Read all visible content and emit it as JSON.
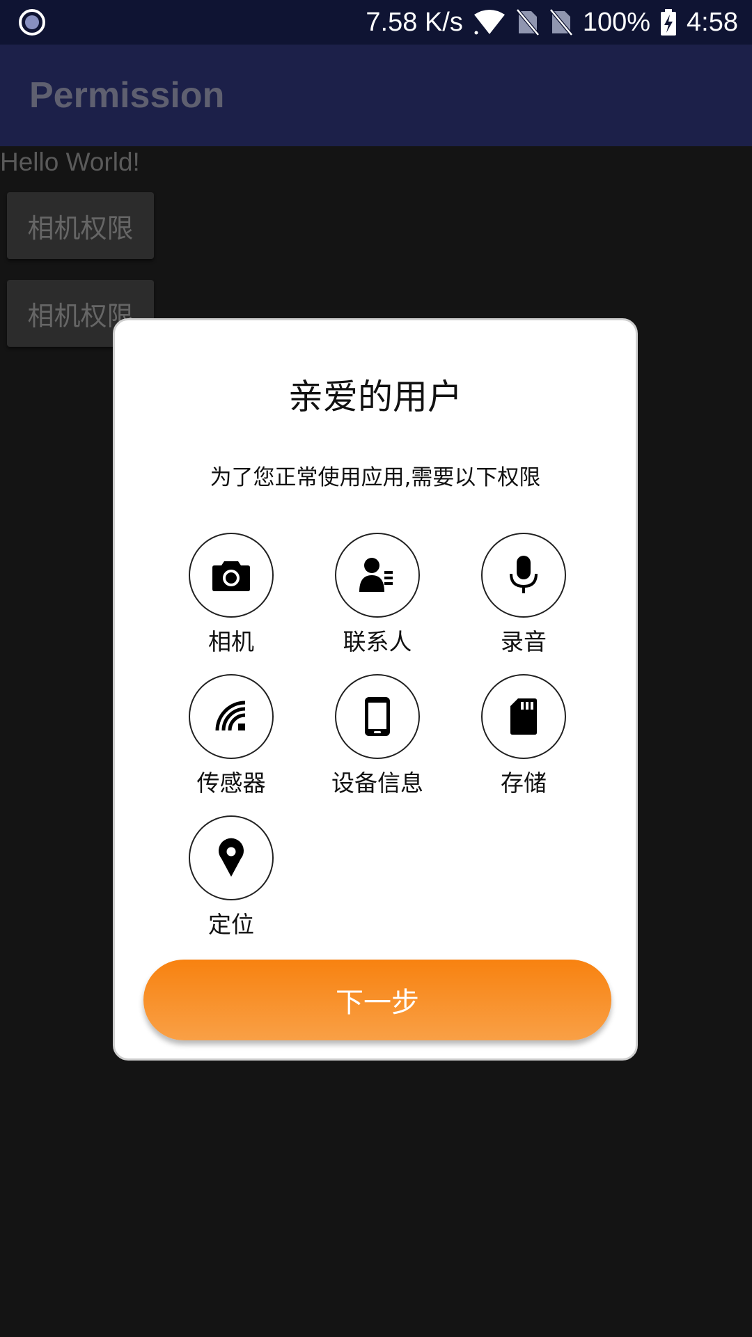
{
  "status_bar": {
    "net_speed": "7.58 K/s",
    "battery": "100%",
    "time": "4:58",
    "icons": [
      "screen-record-icon",
      "wifi-icon",
      "no-sim-icon",
      "no-sim-icon",
      "battery-charging-icon"
    ]
  },
  "app_bar": {
    "title": "Permission"
  },
  "content": {
    "hello_text": "Hello World!",
    "buttons": [
      {
        "label": "相机权限"
      },
      {
        "label": "相机权限"
      }
    ]
  },
  "dialog": {
    "title": "亲爱的用户",
    "subtitle": "为了您正常使用应用,需要以下权限",
    "permissions": [
      {
        "label": "相机",
        "icon": "camera-icon"
      },
      {
        "label": "联系人",
        "icon": "contacts-icon"
      },
      {
        "label": "录音",
        "icon": "microphone-icon"
      },
      {
        "label": "传感器",
        "icon": "sensor-icon"
      },
      {
        "label": "设备信息",
        "icon": "phone-device-icon"
      },
      {
        "label": "存储",
        "icon": "sd-card-icon"
      },
      {
        "label": "定位",
        "icon": "location-pin-icon"
      }
    ],
    "next_button_label": "下一步",
    "accent_color": "#f88a1c"
  }
}
